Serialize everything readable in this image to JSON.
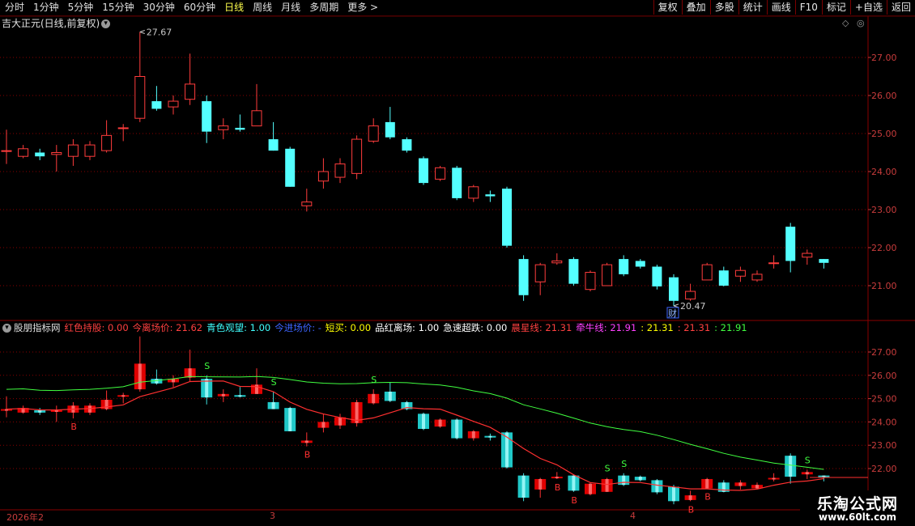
{
  "toolbar": {
    "periods": [
      "分时",
      "1分钟",
      "5分钟",
      "15分钟",
      "30分钟",
      "60分钟",
      "日线",
      "周线",
      "月线",
      "多周期",
      "更多 >"
    ],
    "active_period": "日线",
    "right_buttons": [
      "复权",
      "叠加",
      "多股",
      "统计",
      "画线",
      "F10",
      "标记",
      "+自选",
      "返回"
    ]
  },
  "main_panel": {
    "title": "吉大正元(日线,前复权)",
    "high_label": "27.67",
    "low_label": "20.47",
    "cai_label": "财",
    "y_ticks": [
      "27.00",
      "26.00",
      "25.00",
      "24.00",
      "23.00",
      "22.00",
      "21.00"
    ]
  },
  "indicator": {
    "name": "股朋指标网",
    "fields": [
      {
        "text": "红色持股: 0.00",
        "color": "#ff4040"
      },
      {
        "text": "今离场价: 21.62",
        "color": "#ff4040"
      },
      {
        "text": "青色观望: 1.00",
        "color": "#40ffff"
      },
      {
        "text": "今进场价: -",
        "color": "#3c64ff"
      },
      {
        "text": "短买: 0.00",
        "color": "#ffff00"
      },
      {
        "text": "品红离场: 1.00",
        "color": "#ffffff"
      },
      {
        "text": "急速超跌: 0.00",
        "color": "#ffffff"
      },
      {
        "text": "晨星线: 21.31",
        "color": "#ff4040"
      },
      {
        "text": "牵牛线: 21.91",
        "color": "#ff40ff"
      },
      {
        "text": ": 21.31",
        "color": "#ffff00"
      },
      {
        "text": ": 21.31",
        "color": "#ff4040"
      },
      {
        "text": ": 21.91",
        "color": "#40ff40"
      }
    ],
    "y_ticks": [
      "27.00",
      "26.00",
      "25.00",
      "24.00",
      "23.00",
      "22.00"
    ]
  },
  "date_axis": [
    "2026年2",
    "3",
    "4"
  ],
  "watermark": {
    "title": "乐淘公式网",
    "url": "www.60lt.com"
  },
  "colors": {
    "up": "#ff3c3c",
    "down": "#54ffff",
    "grid": "#8a0000",
    "axis": "#c83c3c",
    "active": "#ffff4c"
  },
  "chart_data": {
    "type": "candlestick",
    "candles": [
      {
        "o": 24.55,
        "c": 24.55,
        "h": 25.1,
        "l": 24.2
      },
      {
        "o": 24.4,
        "c": 24.6,
        "h": 24.7,
        "l": 24.35
      },
      {
        "o": 24.5,
        "c": 24.4,
        "h": 24.6,
        "l": 24.3
      },
      {
        "o": 24.45,
        "c": 24.5,
        "h": 24.7,
        "l": 24.0
      },
      {
        "o": 24.4,
        "c": 24.7,
        "h": 24.85,
        "l": 24.15
      },
      {
        "o": 24.4,
        "c": 24.7,
        "h": 24.8,
        "l": 24.3
      },
      {
        "o": 24.55,
        "c": 24.95,
        "h": 25.35,
        "l": 24.5
      },
      {
        "o": 25.15,
        "c": 25.15,
        "h": 25.25,
        "l": 24.8
      },
      {
        "o": 25.4,
        "c": 26.5,
        "h": 27.67,
        "l": 25.3
      },
      {
        "o": 25.85,
        "c": 25.65,
        "h": 26.25,
        "l": 25.6
      },
      {
        "o": 25.7,
        "c": 25.85,
        "h": 26.0,
        "l": 25.5
      },
      {
        "o": 25.9,
        "c": 26.3,
        "h": 27.1,
        "l": 25.75
      },
      {
        "o": 25.85,
        "c": 25.05,
        "h": 26.0,
        "l": 24.75
      },
      {
        "o": 25.1,
        "c": 25.2,
        "h": 25.4,
        "l": 24.85
      },
      {
        "o": 25.15,
        "c": 25.1,
        "h": 25.5,
        "l": 25.05
      },
      {
        "o": 25.2,
        "c": 25.6,
        "h": 26.3,
        "l": 25.2
      },
      {
        "o": 24.85,
        "c": 24.55,
        "h": 25.3,
        "l": 24.55
      },
      {
        "o": 24.6,
        "c": 23.6,
        "h": 24.65,
        "l": 23.6
      },
      {
        "o": 23.1,
        "c": 23.2,
        "h": 23.55,
        "l": 22.95
      },
      {
        "o": 23.75,
        "c": 24.0,
        "h": 24.35,
        "l": 23.55
      },
      {
        "o": 23.85,
        "c": 24.2,
        "h": 24.35,
        "l": 23.7
      },
      {
        "o": 23.95,
        "c": 24.85,
        "h": 24.95,
        "l": 23.8
      },
      {
        "o": 24.8,
        "c": 25.2,
        "h": 25.4,
        "l": 24.75
      },
      {
        "o": 25.3,
        "c": 24.9,
        "h": 25.7,
        "l": 24.85
      },
      {
        "o": 24.85,
        "c": 24.55,
        "h": 24.9,
        "l": 24.5
      },
      {
        "o": 24.35,
        "c": 23.7,
        "h": 24.4,
        "l": 23.65
      },
      {
        "o": 23.8,
        "c": 24.1,
        "h": 24.15,
        "l": 23.75
      },
      {
        "o": 24.1,
        "c": 23.3,
        "h": 24.15,
        "l": 23.25
      },
      {
        "o": 23.3,
        "c": 23.6,
        "h": 23.65,
        "l": 23.2
      },
      {
        "o": 23.4,
        "c": 23.35,
        "h": 23.5,
        "l": 23.2
      },
      {
        "o": 23.55,
        "c": 22.05,
        "h": 23.6,
        "l": 22.0
      },
      {
        "o": 21.7,
        "c": 20.75,
        "h": 21.8,
        "l": 20.6
      },
      {
        "o": 21.1,
        "c": 21.55,
        "h": 21.6,
        "l": 20.75
      },
      {
        "o": 21.6,
        "c": 21.65,
        "h": 21.85,
        "l": 21.55
      },
      {
        "o": 21.7,
        "c": 21.05,
        "h": 21.75,
        "l": 21.0
      },
      {
        "o": 20.9,
        "c": 21.35,
        "h": 21.4,
        "l": 20.85
      },
      {
        "o": 21.0,
        "c": 21.55,
        "h": 21.6,
        "l": 21.0
      },
      {
        "o": 21.7,
        "c": 21.3,
        "h": 21.8,
        "l": 21.25
      },
      {
        "o": 21.65,
        "c": 21.5,
        "h": 21.7,
        "l": 21.45
      },
      {
        "o": 21.5,
        "c": 20.98,
        "h": 21.55,
        "l": 20.9
      },
      {
        "o": 21.22,
        "c": 20.6,
        "h": 21.3,
        "l": 20.47
      },
      {
        "o": 20.65,
        "c": 20.85,
        "h": 21.05,
        "l": 20.6
      },
      {
        "o": 21.15,
        "c": 21.55,
        "h": 21.6,
        "l": 21.15
      },
      {
        "o": 21.4,
        "c": 21.0,
        "h": 21.5,
        "l": 20.98
      },
      {
        "o": 21.25,
        "c": 21.4,
        "h": 21.5,
        "l": 21.1
      },
      {
        "o": 21.15,
        "c": 21.3,
        "h": 21.4,
        "l": 21.1
      },
      {
        "o": 21.6,
        "c": 21.6,
        "h": 21.8,
        "l": 21.45
      },
      {
        "o": 22.55,
        "c": 21.65,
        "h": 22.65,
        "l": 21.35
      },
      {
        "o": 21.75,
        "c": 21.85,
        "h": 21.95,
        "l": 21.55
      },
      {
        "o": 21.7,
        "c": 21.6,
        "h": 21.7,
        "l": 21.45
      }
    ],
    "y_range": [
      20.2,
      28.0
    ],
    "indicator_signals": [
      "S",
      "S",
      "B",
      "S",
      "B",
      "B",
      "B",
      "S",
      "S",
      "B",
      "S",
      "B"
    ]
  }
}
